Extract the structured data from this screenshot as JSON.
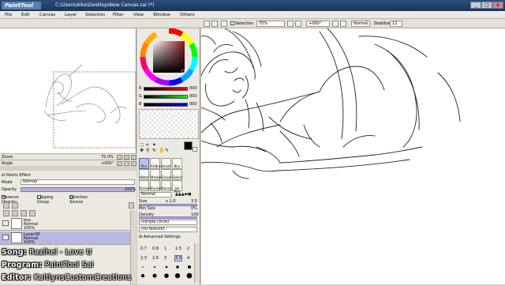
{
  "app": {
    "logo": "PaintTool SAI",
    "window_title": "C:\\Users\\Aiko\\Desktop\\New Canvas.sai (*)",
    "window_buttons": [
      "_",
      "□",
      "x"
    ]
  },
  "menu": [
    "File",
    "Edit",
    "Canvas",
    "Layer",
    "Selection",
    "Filter",
    "View",
    "Window",
    "Others"
  ],
  "toolbar": {
    "selection_label": "Selection",
    "zoom": "75%",
    "angle": "+000°",
    "blend": "Normal",
    "stabilizer_label": "Stabilizer",
    "stabilizer_value": "12"
  },
  "navigator": {
    "zoom_label": "Zoom",
    "zoom_value": "75.0%",
    "angle_label": "Angle",
    "angle_value": "+000°"
  },
  "layer_panel": {
    "paint_effect": "Paints Effect",
    "mode_label": "Mode",
    "mode_value": "Normal",
    "opacity_label": "Opacity",
    "opacity_value": "100%",
    "preserve_opacity": "Preserve Opacity",
    "clipping_group": "Clipping Group",
    "selection_source": "Selection Source",
    "layers": [
      {
        "name": "boy",
        "mode": "Normal",
        "opacity": "100%"
      },
      {
        "name": "Layer28",
        "mode": "Normal",
        "opacity": "100%"
      }
    ]
  },
  "color": {
    "r_label": "R",
    "r_value": "000",
    "g_label": "G",
    "g_value": "000",
    "b_label": "B",
    "b_value": "000",
    "current_color": "#000000",
    "hue_color": "#8a1a22"
  },
  "tools": {
    "row1": [
      "Pen",
      "AirBrush",
      "Brush",
      "Blur"
    ],
    "row2": [
      "Water",
      "Marker",
      "Eraser",
      "Select"
    ],
    "row3": [
      "Deselect",
      "Bucket",
      "Binary",
      "Ink Pen"
    ],
    "blend_mode": "Normal",
    "size_label": "Size",
    "size_multiplier": "x 1.0",
    "size_value": "3.5",
    "min_size_label": "Min Size",
    "min_size_value": "0%",
    "density_label": "Density",
    "density_value": "100",
    "shape": "(simple circle)",
    "texture": "(no texture)",
    "advanced": "Advanced Settings",
    "brush_sizes": [
      [
        "0.7",
        "0.8",
        "1",
        "1.5",
        "2"
      ],
      [
        "2.3",
        "2.6",
        "3",
        "3.5",
        "4"
      ]
    ]
  },
  "captions": {
    "song_label": "Song:",
    "song_value": "Razihel - Love U",
    "program_label": "Program:",
    "program_value": "PaintTool Sai",
    "editor_label": "Editor:",
    "editor_value": "KaitlynsCustomCreations"
  }
}
